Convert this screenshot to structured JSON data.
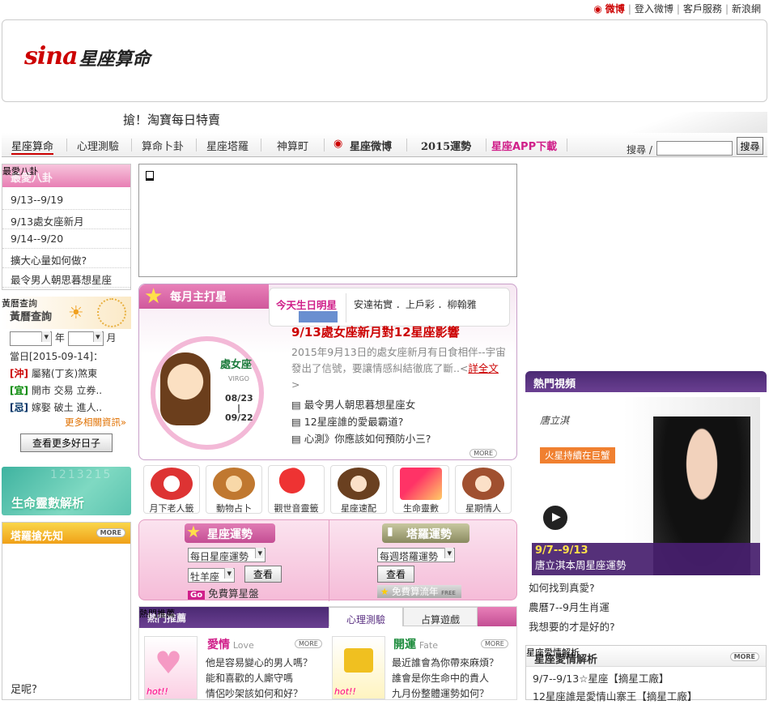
{
  "toplinks": {
    "weibo": "微博",
    "login": "登入微博",
    "service": "客戶服務",
    "home": "新浪網"
  },
  "logo": {
    "sina": "sina",
    "title": "星座算命"
  },
  "promo": "搶！淘寶每日特賣",
  "nav": [
    "星座算命",
    "心理測驗",
    "算命卜卦",
    "星座塔羅",
    "神算町",
    "星座微博",
    "2015運勢",
    "星座APP下載"
  ],
  "search": {
    "label": "搜尋 /",
    "button": "搜尋"
  },
  "gossip": {
    "label": "最愛八卦",
    "title": "最愛八卦",
    "items": [
      "9/13--9/19",
      "9/13處女座新月",
      "9/14--9/20",
      "擴大心量如何做?",
      "最令男人朝思暮想星座"
    ]
  },
  "almanac": {
    "label": "黃曆查詢",
    "title": "黃曆查詢",
    "year": "年",
    "month": "月",
    "date": "當日[2015-09-14]：",
    "rows": [
      {
        "tag": "[沖]",
        "text": "屬豬(丁亥)煞東"
      },
      {
        "tag": "[宜]",
        "text": "開市 交易 立券.."
      },
      {
        "tag": "[忌]",
        "text": "嫁娶 破土 進人.."
      }
    ],
    "more": "更多相關資訊»",
    "button": "查看更多好日子"
  },
  "lifenum": {
    "title": "生命靈數解析"
  },
  "tarot_box": {
    "title": "塔羅搶先知",
    "more": "MORE",
    "bottom": "足呢?"
  },
  "monthly": {
    "title": "每月主打星",
    "tab_active": "今天生日明星",
    "tab_names": "安達祐實 ．上戶彩 ．柳翰雅",
    "sign": "處女座",
    "sign_en": "VIRGO",
    "date_from": "08/23",
    "date_sep": "|",
    "date_to": "09/22",
    "headline": "9/13處女座新月對12星座影響",
    "desc": "2015年9月13日的處女座新月有日食相伴--宇宙發出了信號，要讓情感糾結徹底了斷..<",
    "detail": "詳全文",
    "detail_end": ">",
    "links": [
      "最令男人朝思暮想星座女",
      "12星座誰的愛最霸道?",
      "心測》你應該如何預防小三?"
    ],
    "more": "MORE"
  },
  "services": [
    "月下老人籤",
    "動物占卜",
    "觀世音靈籤",
    "星座速配",
    "生命靈數",
    "星期情人"
  ],
  "fortune": {
    "star_title": "星座運勢",
    "star_select": "每日星座運勢",
    "sign_select": "牡羊座",
    "view": "查看",
    "go": "Go",
    "free_star": "免費算星盤",
    "tarot_title": "塔羅運勢",
    "tarot_select": "每週塔羅運勢",
    "free_tarot": "免費算流年",
    "free": "FREE"
  },
  "hot": {
    "label": "熱門推薦",
    "title": "熱門推薦",
    "tab1": "心理測驗",
    "tab2": "占算遊戲",
    "love_title": "愛情",
    "love_en": "Love",
    "love_lines": [
      "他是容易變心的男人嗎？",
      "能和喜歡的人廝守嗎",
      "情侶吵架該如何和好？"
    ],
    "fate_title": "開運",
    "fate_en": "Fate",
    "fate_lines": [
      "最近誰會為你帶來麻煩？",
      "誰會是你生命中的貴人",
      "九月份整體運勢如何？"
    ],
    "hot_tag": "hot!!",
    "more": "MORE"
  },
  "video": {
    "title": "熱門視頻",
    "caption_small": "火星持續在巨蟹",
    "brand": "唐立淇",
    "date": "9/7--9/13",
    "caption": "唐立淇本周星座運勢",
    "links": [
      "如何找到真愛?",
      "農曆7--9月生肖運",
      "我想要的才是好的?"
    ]
  },
  "lovestar": {
    "label": "星座愛情解析",
    "title": "星座愛情解析",
    "more": "MORE",
    "items": [
      "9/7--9/13☆星座【摘星工廠】",
      "12星座誰是愛情山寨王【摘星工廠】"
    ]
  },
  "colors": {
    "accent": "#cc0000",
    "pink": "#e87fb4",
    "purple": "#5b3283"
  }
}
